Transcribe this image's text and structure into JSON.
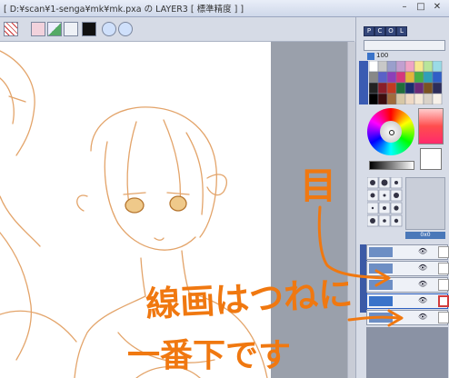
{
  "window": {
    "title": "[ D:¥scan¥1-senga¥mk¥mk.pxa の LAYER3 [ 標準精度 ] ]"
  },
  "panel": {
    "tabs": [
      "P",
      "C",
      "O",
      "L"
    ],
    "brush_size": "100",
    "zoom_readout": "0x0"
  },
  "annotations": {
    "eye_label": "目",
    "line1": "線画はつねに",
    "line2": "一番下です"
  },
  "colors": {
    "accent": "#3a73c9",
    "annotation": "#f07810",
    "lineart": "#e3a46a"
  }
}
